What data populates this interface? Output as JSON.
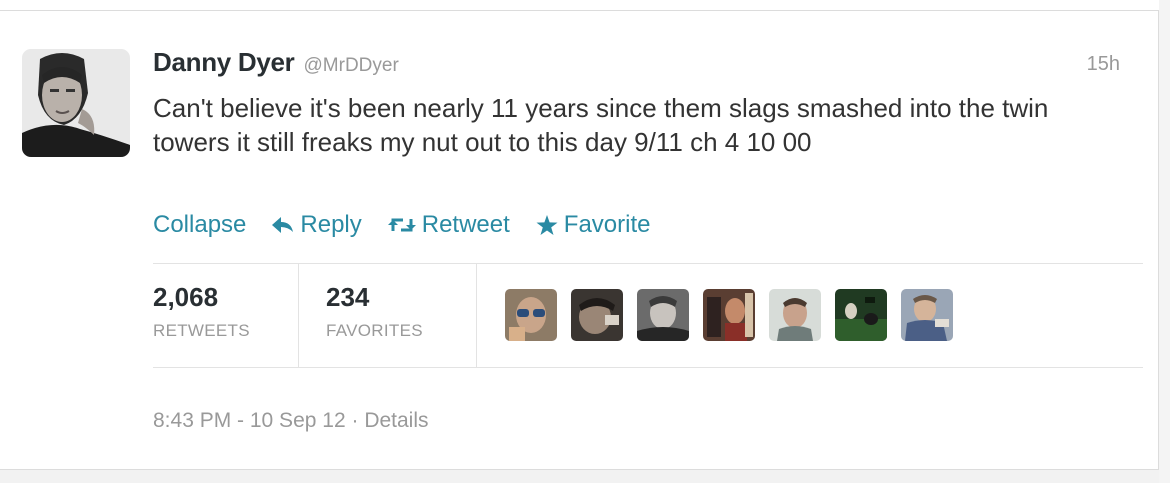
{
  "tweet": {
    "name": "Danny Dyer",
    "handle": "@MrDDyer",
    "time_ago": "15h",
    "text": "Can't believe it's been nearly 11 years since them slags smashed into the twin towers it still freaks my nut out to this day 9/11 ch 4 10 00"
  },
  "actions": {
    "collapse": "Collapse",
    "reply": "Reply",
    "retweet": "Retweet",
    "favorite": "Favorite"
  },
  "stats": {
    "retweets_count": "2,068",
    "retweets_label": "RETWEETS",
    "favorites_count": "234",
    "favorites_label": "FAVORITES"
  },
  "footer": {
    "timestamp": "8:43 PM - 10 Sep 12",
    "separator": "·",
    "details": "Details"
  },
  "icons": {
    "reply": "reply-arrow-icon",
    "retweet": "retweet-icon",
    "favorite": "star-icon"
  },
  "colors": {
    "link": "#2a8aa3",
    "muted": "#999999",
    "text": "#333333"
  }
}
